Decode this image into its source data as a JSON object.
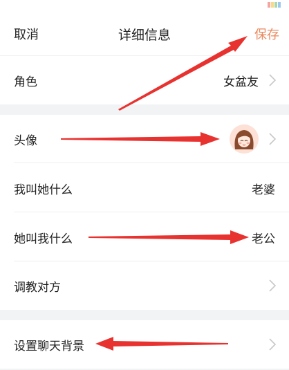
{
  "status_bar": {
    "swatch_colors": [
      "#f5a3a3",
      "#f6d98a",
      "#a8d8a8",
      "#9fc6ef"
    ]
  },
  "header": {
    "cancel_label": "取消",
    "title": "详细信息",
    "save_label": "保存"
  },
  "rows": {
    "role": {
      "label": "角色",
      "value": "女盆友"
    },
    "avatar": {
      "label": "头像"
    },
    "i_call_her": {
      "label": "我叫她什么",
      "value": "老婆"
    },
    "she_calls_me": {
      "label": "她叫我什么",
      "value": "老公"
    },
    "train_partner": {
      "label": "调教对方"
    },
    "chat_background": {
      "label": "设置聊天背景"
    }
  },
  "colors": {
    "accent": "#e98a5f",
    "annotation_arrow": "#e8322f",
    "section_gap": "#f2f3f5"
  }
}
